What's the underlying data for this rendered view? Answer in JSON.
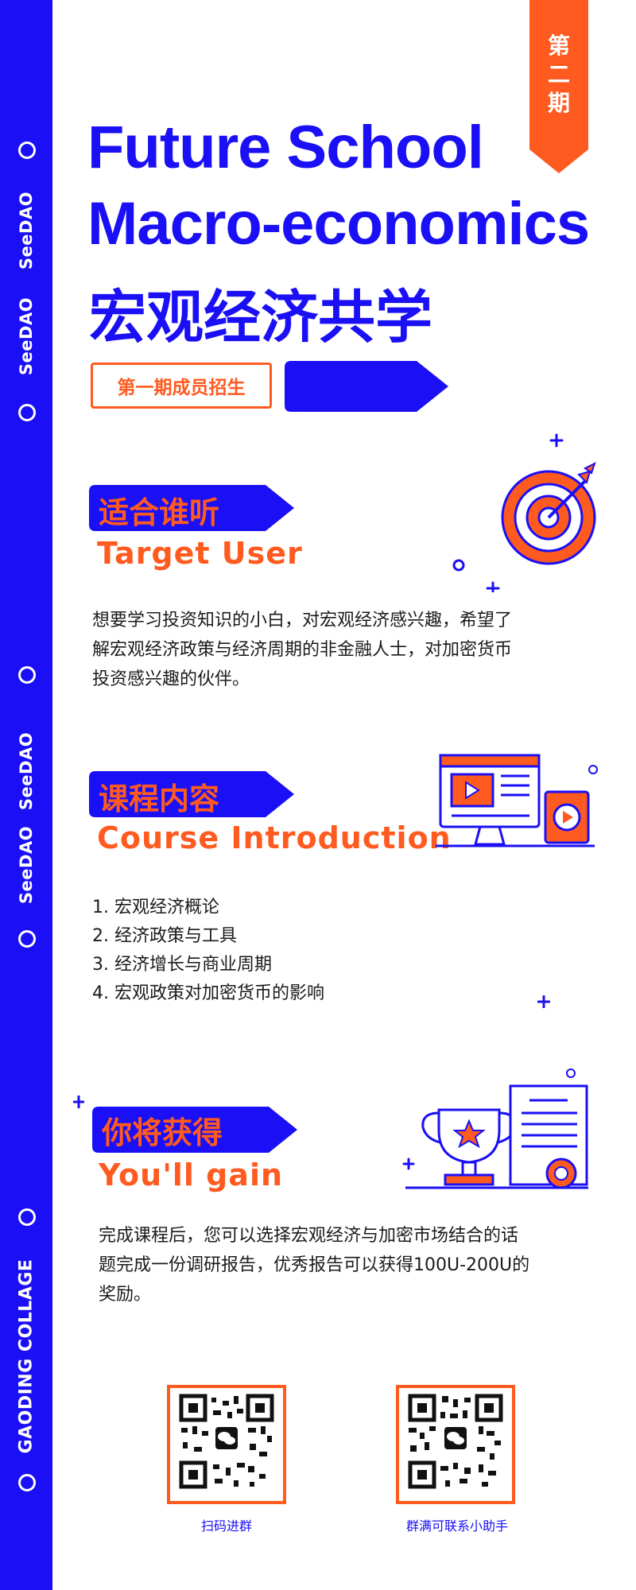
{
  "colors": {
    "brand_blue": "#1a0ff5",
    "accent_orange": "#ff5a1f",
    "text": "#1b1b1b"
  },
  "sidebar": {
    "labels": [
      "SeeDAO",
      "SeeDAO",
      "SeeDAO",
      "SeeDAO",
      "GAODING COLLAGE"
    ]
  },
  "ribbon": {
    "line1": "第",
    "line2": "二",
    "line3": "期"
  },
  "header": {
    "title_line1": "Future School",
    "title_line2": "Macro-economics",
    "title_cn": "宏观经济共学",
    "recruit_label": "第一期成员招生"
  },
  "sections": {
    "target": {
      "tag": "适合谁听",
      "en": "Target User",
      "body_lines": [
        "想要学习投资知识的小白，对宏观经济感兴趣，希望了",
        "解宏观经济政策与经济周期的非金融人士，对加密货币",
        "投资感兴趣的伙伴。"
      ],
      "icon": "target-icon"
    },
    "course": {
      "tag": "课程内容",
      "en": "Course Introduction",
      "items": [
        "1. 宏观经济概论",
        "2. 经济政策与工具",
        "3. 经济增长与商业周期",
        "4. 宏观政策对加密货币的影响"
      ],
      "icon": "video-course-icon"
    },
    "gain": {
      "tag": "你将获得",
      "en": "You'll gain",
      "body_lines": [
        "完成课程后，您可以选择宏观经济与加密市场结合的话",
        "题完成一份调研报告，优秀报告可以获得100U-200U的",
        "奖励。"
      ],
      "icon": "trophy-certificate-icon"
    }
  },
  "qr": {
    "left_label": "扫码进群",
    "right_label": "群满可联系小助手",
    "icon": "qr-code-icon"
  }
}
